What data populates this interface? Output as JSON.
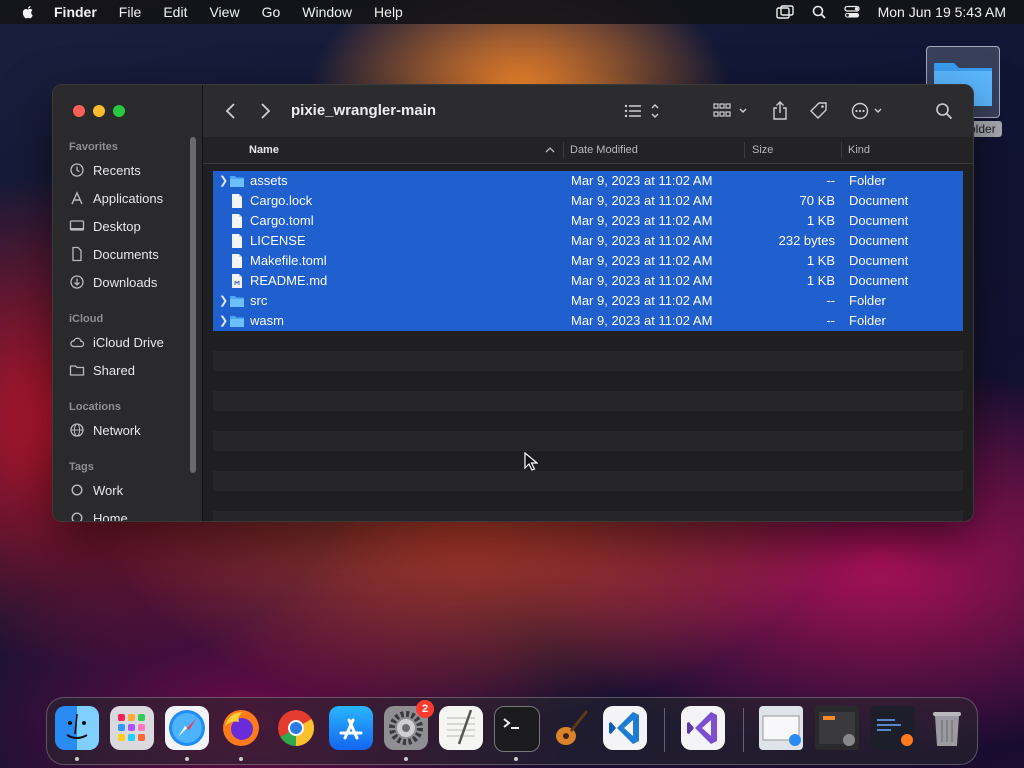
{
  "menubar": {
    "app_name": "Finder",
    "items": [
      "File",
      "Edit",
      "View",
      "Go",
      "Window",
      "Help"
    ],
    "clock": "Mon Jun 19  5:43 AM"
  },
  "desktop": {
    "folder_label": "older"
  },
  "window": {
    "title": "pixie_wrangler-main",
    "sidebar": {
      "favorites_header": "Favorites",
      "favorites": [
        "Recents",
        "Applications",
        "Desktop",
        "Documents",
        "Downloads"
      ],
      "icloud_header": "iCloud",
      "icloud": [
        "iCloud Drive",
        "Shared"
      ],
      "locations_header": "Locations",
      "locations": [
        "Network"
      ],
      "tags_header": "Tags",
      "tags": [
        "Work",
        "Home"
      ]
    },
    "columns": {
      "name": "Name",
      "date": "Date Modified",
      "size": "Size",
      "kind": "Kind"
    },
    "files": [
      {
        "name": "assets",
        "date": "Mar 9, 2023 at 11:02 AM",
        "size": "--",
        "kind": "Folder",
        "type": "folder"
      },
      {
        "name": "Cargo.lock",
        "date": "Mar 9, 2023 at 11:02 AM",
        "size": "70 KB",
        "kind": "Document",
        "type": "doc"
      },
      {
        "name": "Cargo.toml",
        "date": "Mar 9, 2023 at 11:02 AM",
        "size": "1 KB",
        "kind": "Document",
        "type": "doc"
      },
      {
        "name": "LICENSE",
        "date": "Mar 9, 2023 at 11:02 AM",
        "size": "232 bytes",
        "kind": "Document",
        "type": "doc"
      },
      {
        "name": "Makefile.toml",
        "date": "Mar 9, 2023 at 11:02 AM",
        "size": "1 KB",
        "kind": "Document",
        "type": "doc"
      },
      {
        "name": "README.md",
        "date": "Mar 9, 2023 at 11:02 AM",
        "size": "1 KB",
        "kind": "Document",
        "type": "doc"
      },
      {
        "name": "src",
        "date": "Mar 9, 2023 at 11:02 AM",
        "size": "--",
        "kind": "Folder",
        "type": "folder"
      },
      {
        "name": "wasm",
        "date": "Mar 9, 2023 at 11:02 AM",
        "size": "--",
        "kind": "Folder",
        "type": "folder"
      }
    ]
  },
  "dock": {
    "apps": [
      "Finder",
      "Launchpad",
      "Safari",
      "Firefox",
      "Chrome",
      "App Store",
      "System Settings",
      "TextEdit",
      "Terminal",
      "GarageBand",
      "Visual Studio Code",
      "Visual Studio"
    ],
    "settings_badge": "2"
  },
  "colors": {
    "selection": "#1f5fce",
    "folder": "#4aa8ff",
    "close": "#ff5f57",
    "minimize": "#febc2e",
    "maximize": "#28c840"
  }
}
